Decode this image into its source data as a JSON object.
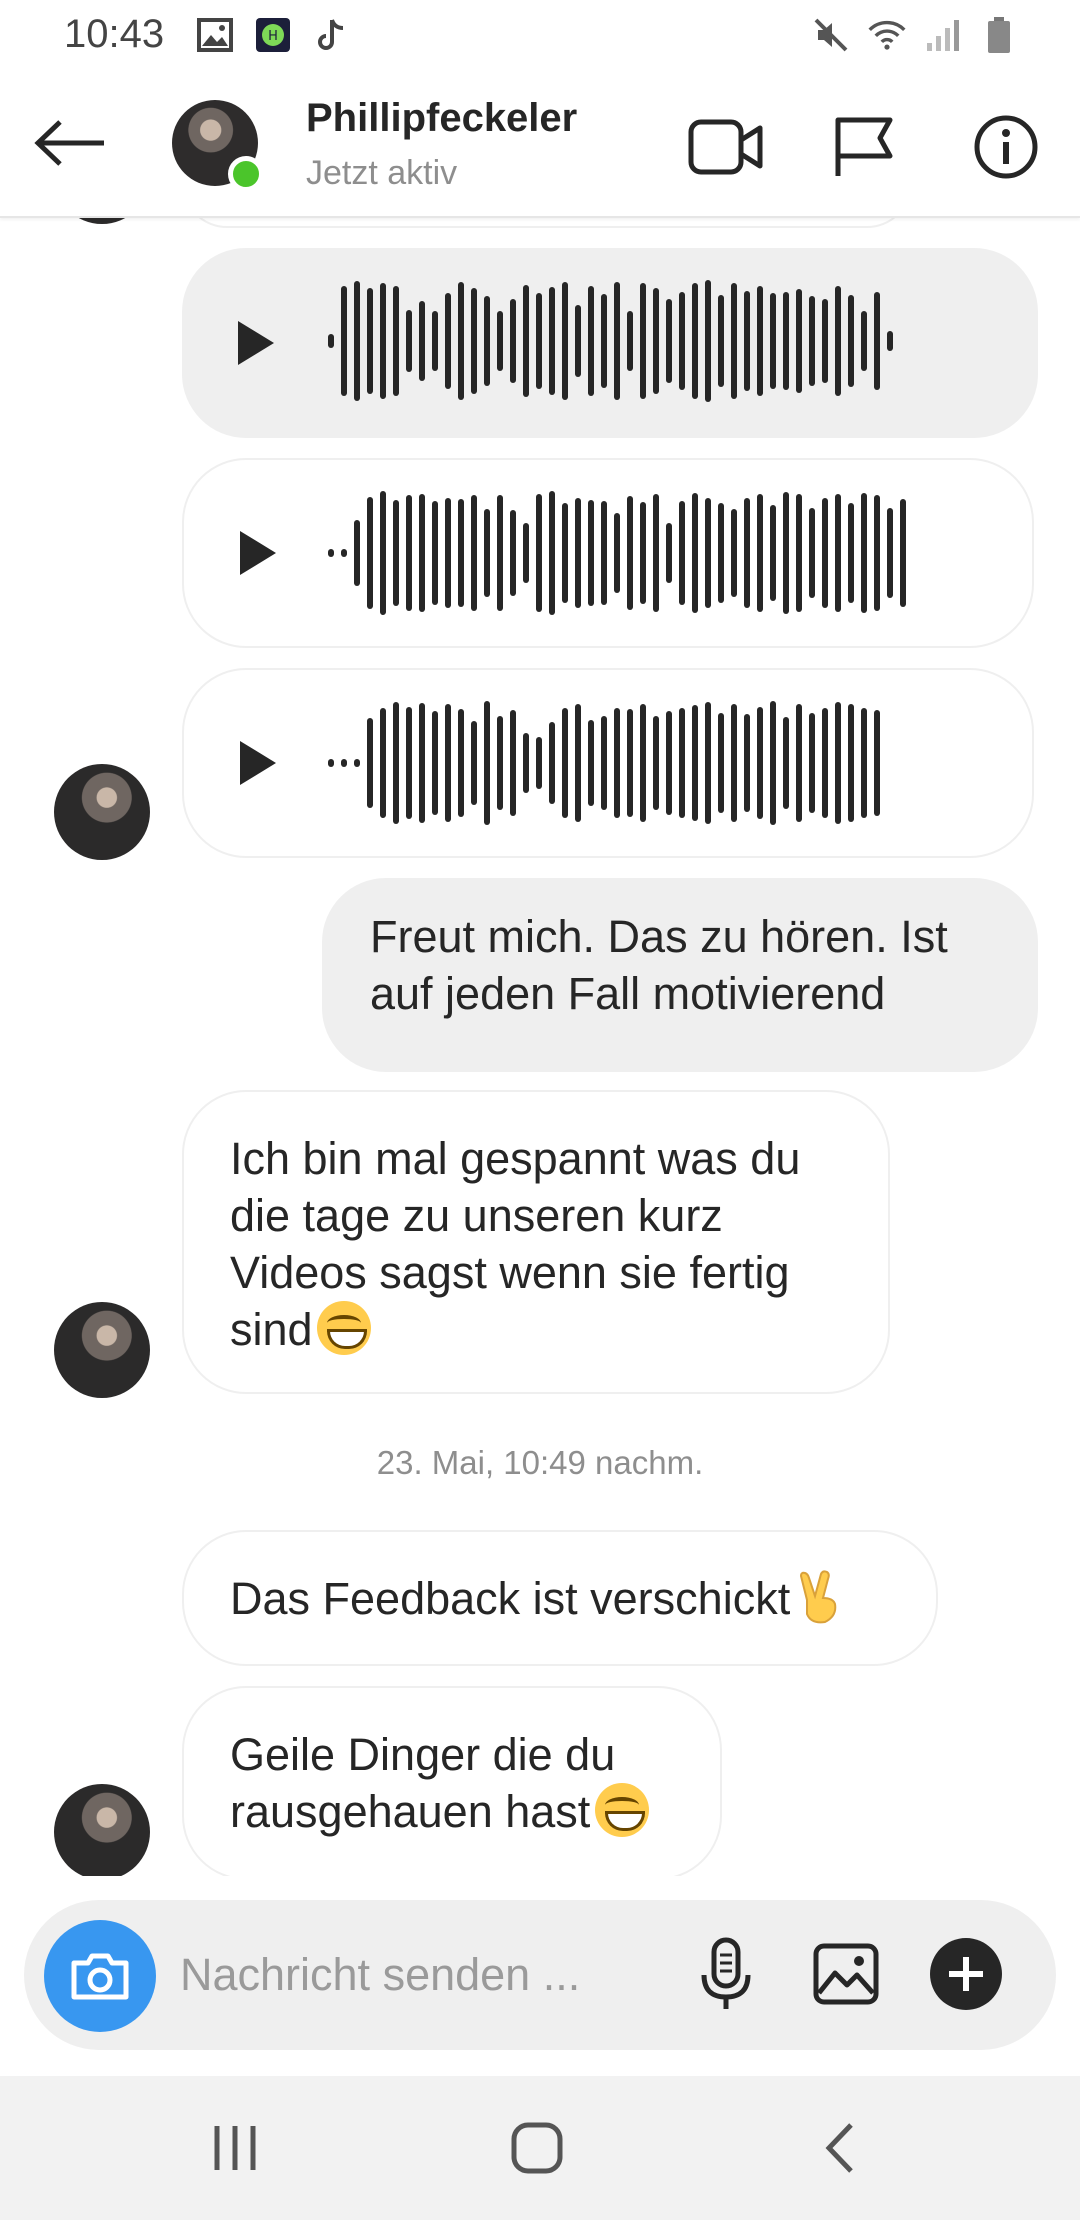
{
  "status_bar": {
    "time": "10:43",
    "left_icons": [
      "image-icon",
      "app-icon",
      "tiktok-icon"
    ],
    "right_icons": [
      "mute-icon",
      "wifi-icon",
      "signal-icon",
      "battery-icon"
    ]
  },
  "header": {
    "name": "Phillipfeckeler",
    "status": "Jetzt aktiv",
    "actions": [
      "video-call-icon",
      "flag-icon",
      "info-icon"
    ]
  },
  "messages": [
    {
      "type": "voice",
      "direction": "in"
    },
    {
      "type": "voice",
      "direction": "in"
    },
    {
      "type": "voice",
      "direction": "in"
    },
    {
      "type": "text",
      "direction": "out",
      "text": "Freut mich. Das zu hören. Ist auf jeden Fall motivierend"
    },
    {
      "type": "text",
      "direction": "in",
      "text": "Ich bin mal gespannt was du die tage zu unseren kurz Videos sagst wenn sie fertig sind"
    },
    {
      "type": "text",
      "direction": "in",
      "text": "Das Feedback ist verschickt"
    },
    {
      "type": "text",
      "direction": "in",
      "text": "Geile Dinger die du rausgehauen hast"
    }
  ],
  "timestamp": "23. Mai, 10:49 nachm.",
  "composer": {
    "placeholder": "Nachricht senden ..."
  },
  "colors": {
    "accent": "#3897f0",
    "online": "#4bc52b",
    "bubble_gray": "#efefef"
  }
}
